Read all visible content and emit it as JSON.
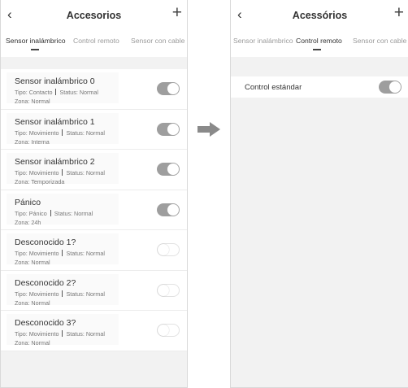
{
  "left": {
    "back": "‹",
    "title": "Accesorios",
    "add": "+",
    "tabs": [
      "Sensor inalámbrico",
      "Control remoto",
      "Sensor con cable"
    ],
    "active_tab": 0,
    "items": [
      {
        "name": "Sensor inalámbrico 0",
        "type": "Tipo: Contacto",
        "status": "Status: Normal",
        "zone": "Zona: Normal",
        "enabled": true
      },
      {
        "name": "Sensor inalámbrico 1",
        "type": "Tipo: Movimiento",
        "status": "Status: Normal",
        "zone": "Zona: Interna",
        "enabled": true
      },
      {
        "name": "Sensor inalámbrico 2",
        "type": "Tipo: Movimiento",
        "status": "Status: Normal",
        "zone": "Zona: Temporizada",
        "enabled": true
      },
      {
        "name": "Pánico",
        "type": "Tipo: Pánico",
        "status": "Status: Normal",
        "zone": "Zona: 24h",
        "enabled": true
      },
      {
        "name": "Desconocido 1?",
        "type": "Tipo: Movimiento",
        "status": "Status: Normal",
        "zone": "Zona: Normal",
        "enabled": false
      },
      {
        "name": "Desconocido 2?",
        "type": "Tipo: Movimiento",
        "status": "Status: Normal",
        "zone": "Zona: Normal",
        "enabled": false
      },
      {
        "name": "Desconocido 3?",
        "type": "Tipo: Movimiento",
        "status": "Status: Normal",
        "zone": "Zona: Normal",
        "enabled": false
      }
    ]
  },
  "right": {
    "back": "‹",
    "title": "Acessórios",
    "add": "+",
    "tabs": [
      "Sensor inalámbrico",
      "Control remoto",
      "Sensor con cable"
    ],
    "active_tab": 1,
    "items": [
      {
        "name": "Control estándar",
        "enabled": true
      }
    ]
  },
  "colors": {
    "toggle_on": "#9e9e9e",
    "toggle_off": "#ffffff",
    "background": "#f2f2f2",
    "arrow": "#8a8a8a"
  }
}
